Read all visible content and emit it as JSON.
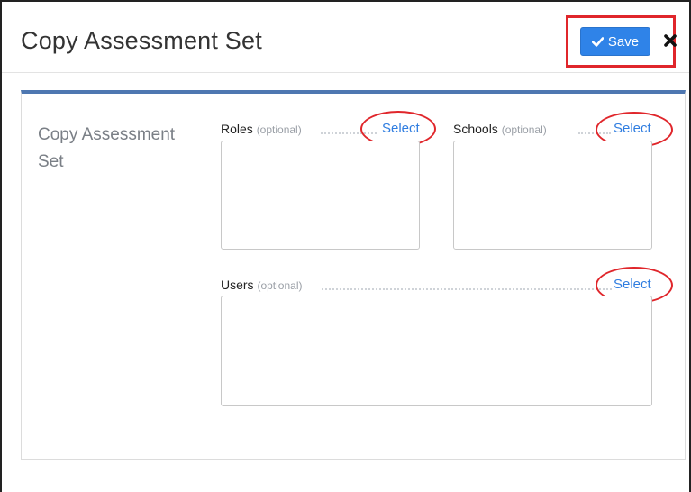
{
  "modal": {
    "title": "Copy Assessment Set",
    "save_label": "Save",
    "close_icon": "close-icon",
    "accent_color": "#4e77b1",
    "button_color": "#2f83e8",
    "highlight_color": "#e0262b"
  },
  "section": {
    "label": "Copy Assessment Set"
  },
  "fields": {
    "roles": {
      "label": "Roles",
      "optional": "(optional)",
      "select": "Select"
    },
    "schools": {
      "label": "Schools",
      "optional": "(optional)",
      "select": "Select"
    },
    "users": {
      "label": "Users",
      "optional": "(optional)",
      "select": "Select"
    }
  }
}
